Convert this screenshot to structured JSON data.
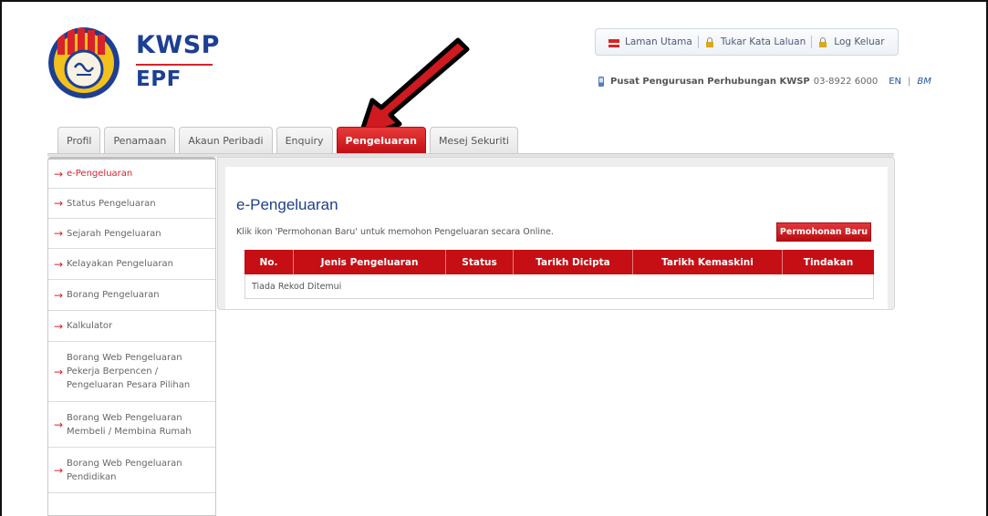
{
  "brand": {
    "kwsp": "KWSP",
    "epf": "EPF",
    "colors": {
      "blue": "#1d3f93",
      "red": "#d8222a",
      "gold": "#f2c11c"
    }
  },
  "top_links": [
    {
      "label": "Laman Utama",
      "icon": "home-icon"
    },
    {
      "label": "Tukar Kata Laluan",
      "icon": "lock-icon"
    },
    {
      "label": "Log Keluar",
      "icon": "logout-lock-icon"
    }
  ],
  "hotline": {
    "label": "Pusat Pengurusan Perhubungan KWSP",
    "number": "03-8922 6000",
    "lang_en": "EN",
    "lang_sep": "|",
    "lang_bm": "BM"
  },
  "tabs": [
    {
      "label": "Profil",
      "active": false
    },
    {
      "label": "Penamaan",
      "active": false
    },
    {
      "label": "Akaun Peribadi",
      "active": false
    },
    {
      "label": "Enquiry",
      "active": false
    },
    {
      "label": "Pengeluaran",
      "active": true
    },
    {
      "label": "Mesej Sekuriti",
      "active": false
    }
  ],
  "sidebar": {
    "items": [
      {
        "label": "e-Pengeluaran",
        "active": true
      },
      {
        "label": "Status Pengeluaran"
      },
      {
        "label": "Sejarah Pengeluaran"
      },
      {
        "label": "Kelayakan Pengeluaran"
      },
      {
        "label": "Borang Pengeluaran"
      },
      {
        "label": "Kalkulator"
      },
      {
        "label": "Borang Web Pengeluaran Pekerja Berpencen / Pengeluaran Pesara Pilihan"
      },
      {
        "label": "Borang Web Pengeluaran Membeli / Membina Rumah"
      },
      {
        "label": "Borang Web Pengeluaran Pendidikan"
      }
    ]
  },
  "main": {
    "title": "e-Pengeluaran",
    "instruction": "Klik ikon 'Permohonan Baru' untuk memohon Pengeluaran secara Online.",
    "new_button": "Permohonan Baru",
    "table": {
      "columns": [
        "No.",
        "Jenis Pengeluaran",
        "Status",
        "Tarikh Dicipta",
        "Tarikh Kemaskini",
        "Tindakan"
      ],
      "empty_text": "Tiada Rekod Ditemui"
    }
  }
}
